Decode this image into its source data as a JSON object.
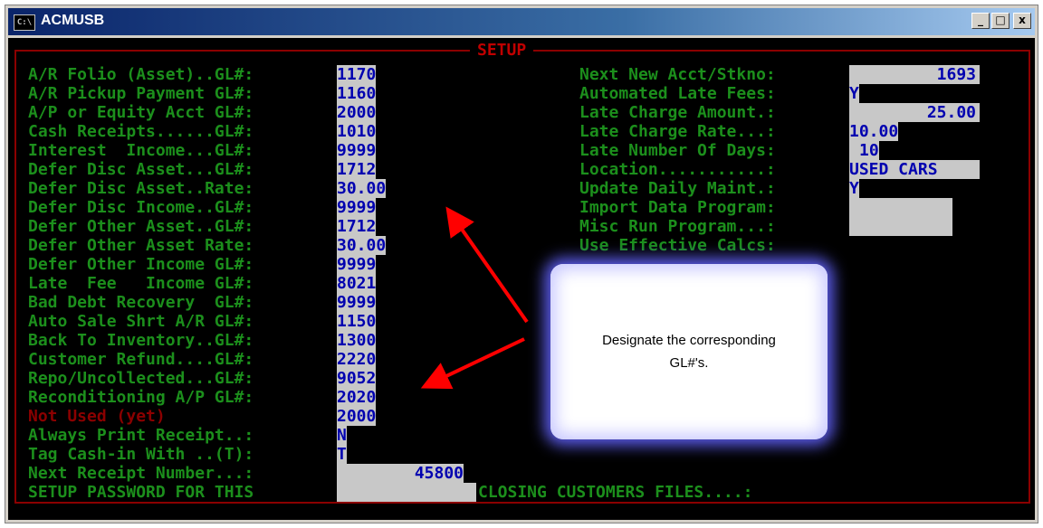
{
  "window": {
    "title": "ACMUSB",
    "icon": "console-icon",
    "minimize": "_",
    "maximize": "□",
    "close": "x"
  },
  "setup_title": "SETUP",
  "left_fields": [
    {
      "label": "A/R Folio (Asset)..GL#:",
      "value": "1170"
    },
    {
      "label": "A/R Pickup Payment GL#:",
      "value": "1160"
    },
    {
      "label": "A/P or Equity Acct GL#:",
      "value": "2000"
    },
    {
      "label": "Cash Receipts......GL#:",
      "value": "1010"
    },
    {
      "label": "Interest  Income...GL#:",
      "value": "9999"
    },
    {
      "label": "Defer Disc Asset...GL#:",
      "value": "1712"
    },
    {
      "label": "Defer Disc Asset..Rate:",
      "value": "30.00"
    },
    {
      "label": "Defer Disc Income..GL#:",
      "value": "9999"
    },
    {
      "label": "Defer Other Asset..GL#:",
      "value": "1712"
    },
    {
      "label": "Defer Other Asset Rate:",
      "value": "30.00"
    },
    {
      "label": "Defer Other Income GL#:",
      "value": "9999"
    },
    {
      "label": "Late  Fee   Income GL#:",
      "value": "8021"
    },
    {
      "label": "Bad Debt Recovery  GL#:",
      "value": "9999"
    },
    {
      "label": "Auto Sale Shrt A/R GL#:",
      "value": "1150"
    },
    {
      "label": "Back To Inventory..GL#:",
      "value": "1300"
    },
    {
      "label": "Customer Refund....GL#:",
      "value": "2220"
    },
    {
      "label": "Repo/Uncollected...GL#:",
      "value": "9052"
    },
    {
      "label": "Reconditioning A/P GL#:",
      "value": "2020"
    },
    {
      "label": "Not Used (yet)",
      "value": "2000"
    },
    {
      "label": "Always Print Receipt..:",
      "value": "N"
    },
    {
      "label": "Tag Cash-in With ..(T):",
      "value": "T"
    },
    {
      "label": "Next Receipt Number...:",
      "value": "45800"
    },
    {
      "label": "SETUP PASSWORD FOR THIS",
      "value": ""
    }
  ],
  "right_fields": [
    {
      "label": "Next New Acct/Stkno:",
      "value": "1693"
    },
    {
      "label": "Automated Late Fees:",
      "value": "Y"
    },
    {
      "label": "Late Charge Amount.:",
      "value": "25.00"
    },
    {
      "label": "Late Charge Rate...:",
      "value": "10.00"
    },
    {
      "label": "Late Number Of Days:",
      "value": "10"
    },
    {
      "label": "Location...........:",
      "value": "USED CARS"
    },
    {
      "label": "Update Daily Maint.:",
      "value": "Y"
    },
    {
      "label": "Import Data Program:",
      "value": ""
    },
    {
      "label": "Misc Run Program...:",
      "value": ""
    },
    {
      "label": "Use Effective Calcs:",
      "value": ""
    }
  ],
  "closing_text": "CLOSING CUSTOMERS FILES....:",
  "callout": {
    "line1": "Designate the corresponding",
    "line2": "GL#'s."
  },
  "colors": {
    "label": "#1c8f1c",
    "disabled_label": "#8b0000",
    "value_text": "#0000b0",
    "field_bg": "#c8c8c8",
    "frame": "#8b0000",
    "arrow": "#ff0000"
  }
}
